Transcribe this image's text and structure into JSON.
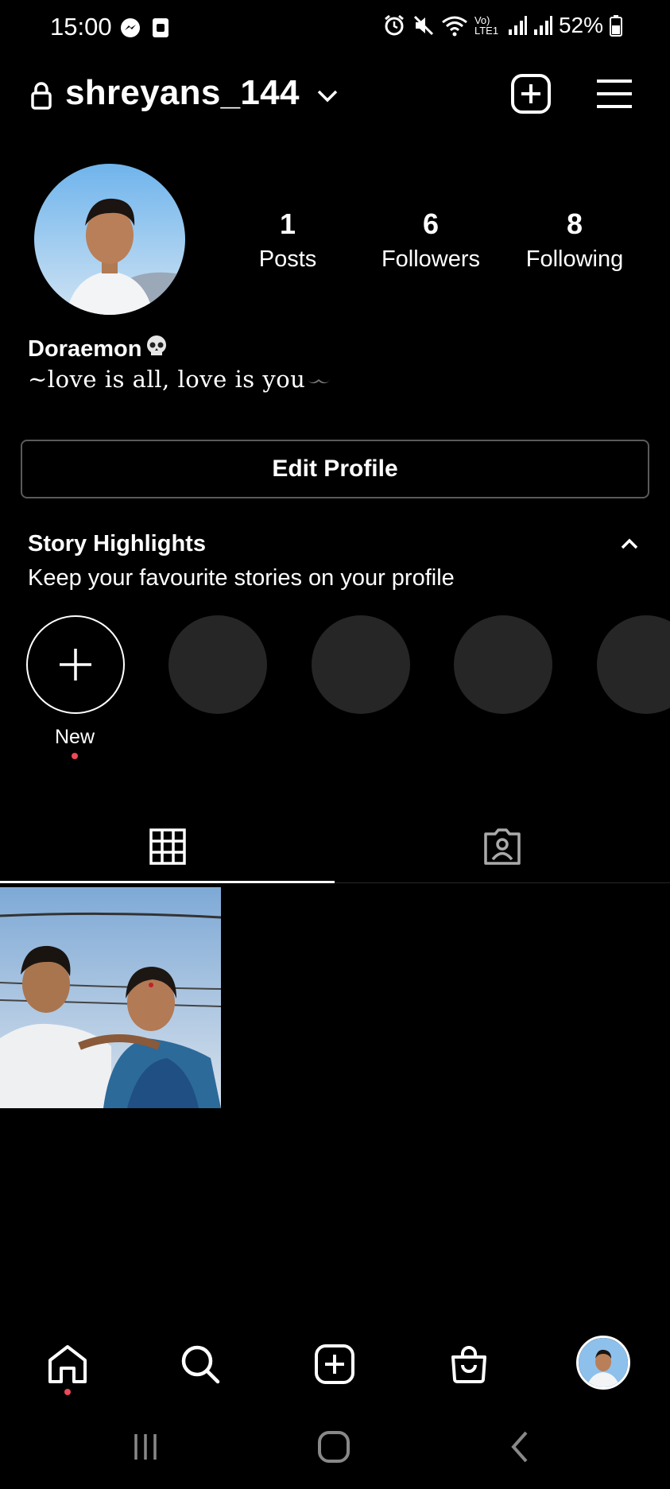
{
  "status_bar": {
    "time": "15:00",
    "battery": "52%",
    "network": "Vo) LTE1",
    "left_icons": [
      "messenger-icon",
      "screenshot-icon"
    ],
    "right_icons": [
      "alarm-icon",
      "mute-icon",
      "wifi-icon",
      "signal-icon",
      "signal-icon",
      "battery-icon"
    ]
  },
  "header": {
    "username": "shreyans_144",
    "icons": [
      "lock-icon",
      "chevron-down-icon",
      "new-post-icon",
      "menu-icon"
    ]
  },
  "profile": {
    "posts_count": "1",
    "posts_label": "Posts",
    "followers_count": "6",
    "followers_label": "Followers",
    "following_count": "8",
    "following_label": "Following",
    "display_name": "Doraemon",
    "display_name_emoji": "skull-emoji",
    "bio": "~love is all, love is you",
    "bio_emoji": "mustache-emoji",
    "edit_profile_label": "Edit Profile"
  },
  "highlights": {
    "title": "Story Highlights",
    "subtitle": "Keep your favourite stories on your profile",
    "new_label": "New"
  },
  "tabs": {
    "items": [
      "grid-icon",
      "tagged-icon"
    ],
    "active": "grid-icon"
  },
  "bottom_nav": {
    "items": [
      "home-icon",
      "search-icon",
      "create-icon",
      "shop-icon",
      "profile-avatar"
    ]
  },
  "colors": {
    "background": "#000000",
    "text": "#ffffff",
    "placeholder_circle": "#262626",
    "notification_dot": "#ed4956",
    "border": "#5a5a5a"
  }
}
